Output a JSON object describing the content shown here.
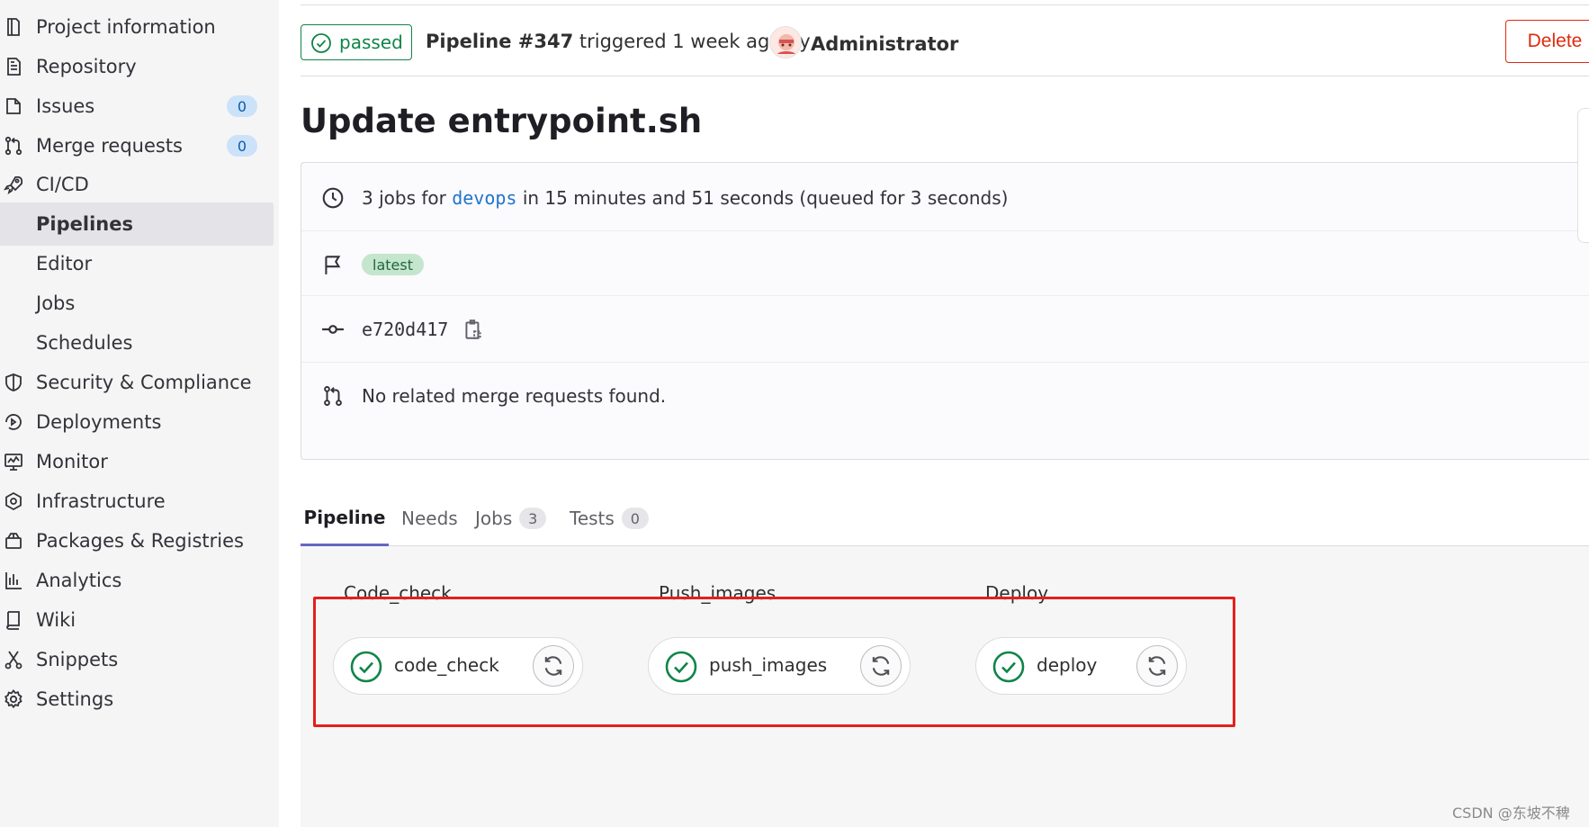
{
  "sidebar": {
    "items": [
      {
        "label": "Project information",
        "icon": "project-icon"
      },
      {
        "label": "Repository",
        "icon": "repository-icon"
      },
      {
        "label": "Issues",
        "icon": "issues-icon",
        "count": "0"
      },
      {
        "label": "Merge requests",
        "icon": "merge-request-icon",
        "count": "0"
      },
      {
        "label": "CI/CD",
        "icon": "rocket-icon"
      },
      {
        "label": "Pipelines",
        "active": true
      },
      {
        "label": "Editor"
      },
      {
        "label": "Jobs"
      },
      {
        "label": "Schedules"
      },
      {
        "label": "Security & Compliance",
        "icon": "shield-icon"
      },
      {
        "label": "Deployments",
        "icon": "deployments-icon"
      },
      {
        "label": "Monitor",
        "icon": "monitor-icon"
      },
      {
        "label": "Infrastructure",
        "icon": "infrastructure-icon"
      },
      {
        "label": "Packages & Registries",
        "icon": "package-icon"
      },
      {
        "label": "Analytics",
        "icon": "analytics-icon"
      },
      {
        "label": "Wiki",
        "icon": "book-icon"
      },
      {
        "label": "Snippets",
        "icon": "snippet-icon"
      },
      {
        "label": "Settings",
        "icon": "gear-icon"
      }
    ]
  },
  "header": {
    "status": "passed",
    "pipeline_label": "Pipeline #347",
    "triggered_text": "triggered 1 week ago by",
    "author": "Administrator",
    "delete_label": "Delete"
  },
  "title": "Update entrypoint.sh",
  "info": {
    "jobs_prefix": "3 jobs for",
    "branch": "devops",
    "jobs_suffix": "in 15 minutes and 51 seconds (queued for 3 seconds)",
    "badge": "latest",
    "commit_sha": "e720d417",
    "merge_requests": "No related merge requests found."
  },
  "tabs": [
    {
      "label": "Pipeline",
      "active": true
    },
    {
      "label": "Needs"
    },
    {
      "label": "Jobs",
      "count": "3"
    },
    {
      "label": "Tests",
      "count": "0"
    }
  ],
  "stages": [
    {
      "name": "Code_check",
      "job": "code_check",
      "status": "success"
    },
    {
      "name": "Push_images",
      "job": "push_images",
      "status": "success"
    },
    {
      "name": "Deploy",
      "job": "deploy",
      "status": "success"
    }
  ],
  "watermark": "CSDN @东坡不稗",
  "colors": {
    "success": "#108548",
    "link": "#1f75cb",
    "danger": "#dd2b0e",
    "highlight": "#e3201b"
  }
}
